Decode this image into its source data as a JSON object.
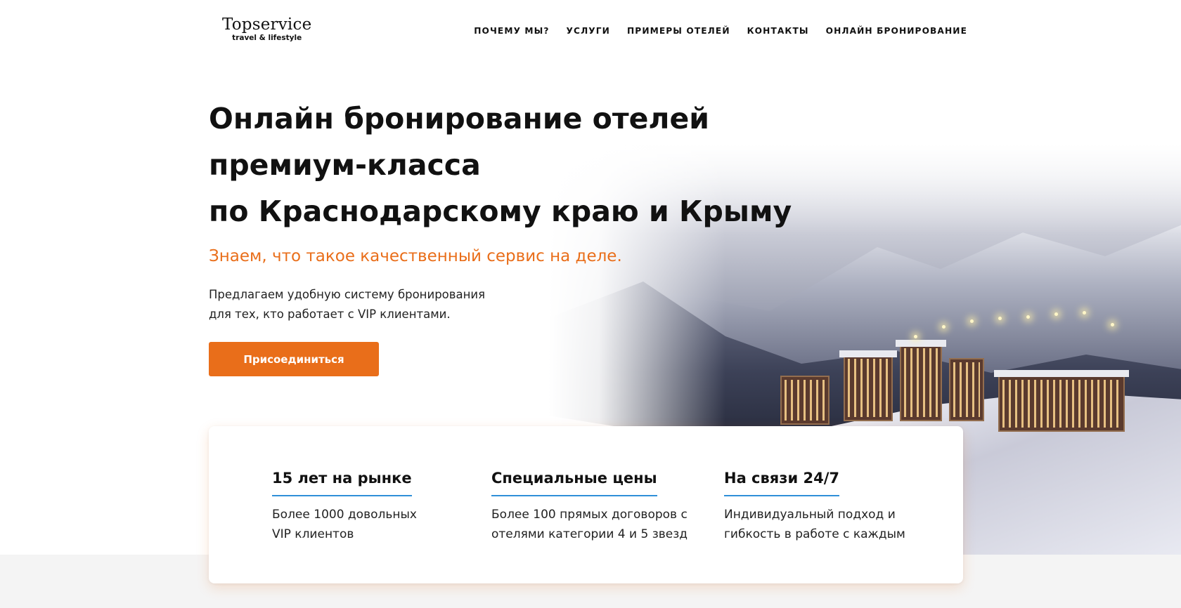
{
  "header": {
    "logo_brand": "Topservice",
    "logo_tagline": "travel & lifestyle",
    "nav": [
      {
        "label": "ПОЧЕМУ МЫ?"
      },
      {
        "label": "УСЛУГИ"
      },
      {
        "label": "ПРИМЕРЫ ОТЕЛЕЙ"
      },
      {
        "label": "КОНТАКТЫ"
      },
      {
        "label": "ОНЛАЙН БРОНИРОВАНИЕ"
      }
    ]
  },
  "hero": {
    "title_line1": "Онлайн бронирование отелей",
    "title_line2": "премиум-класса",
    "title_line3": "по Краснодарскому краю и Крыму",
    "subtitle": "Знаем, что такое качественный сервис на деле.",
    "desc_line1": "Предлагаем удобную систему бронирования",
    "desc_line2": "для тех, кто работает с VIP клиентами.",
    "cta_label": "Присоединиться"
  },
  "features": [
    {
      "title": "15 лет на рынке",
      "line1": "Более 1000 довольных",
      "line2": "VIP клиентов"
    },
    {
      "title": "Специальные цены",
      "line1": "Более 100 прямых договоров с",
      "line2": "отелями категории 4 и 5 звезд"
    },
    {
      "title": "На связи 24/7",
      "line1": "Индивидуальный подход и",
      "line2": "гибкость в работе с каждым"
    }
  ],
  "colors": {
    "accent": "#e96e1a",
    "underline": "#2f8fd8",
    "text": "#111111"
  }
}
